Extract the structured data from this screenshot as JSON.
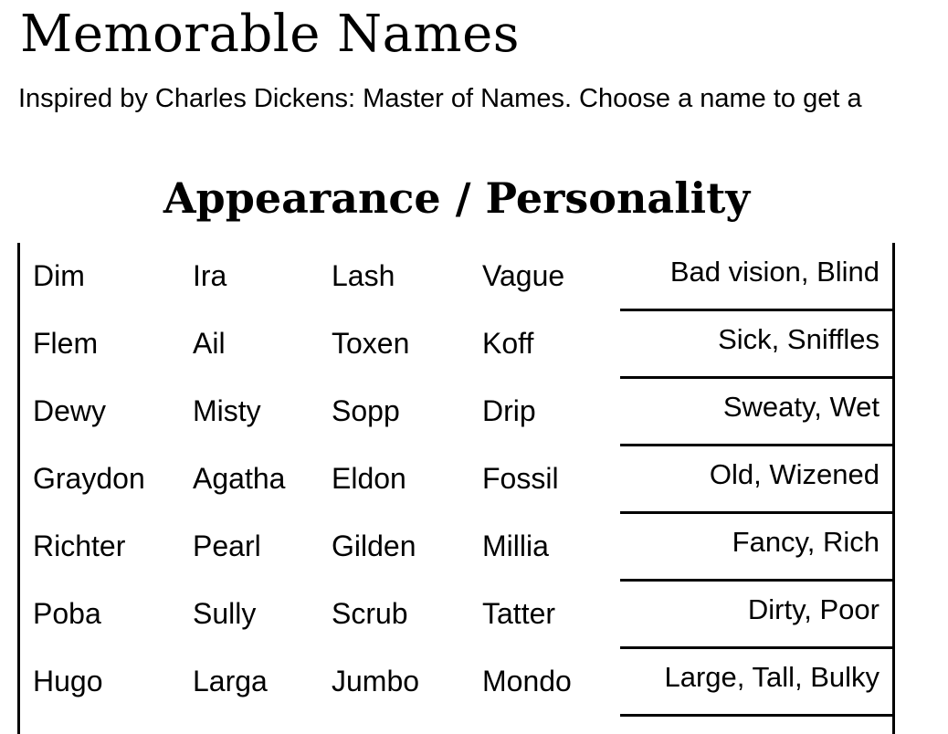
{
  "page": {
    "title": "Memorable Names",
    "subtitle": "Inspired by Charles Dickens: Master of Names. Choose a name to get a"
  },
  "section": {
    "heading": "Appearance / Personality",
    "rows": [
      {
        "names": [
          "Dim",
          "Ira",
          "Lash",
          "Vague"
        ],
        "trait": "Bad vision, Blind"
      },
      {
        "names": [
          "Flem",
          "Ail",
          "Toxen",
          "Koff"
        ],
        "trait": "Sick, Sniffles"
      },
      {
        "names": [
          "Dewy",
          "Misty",
          "Sopp",
          "Drip"
        ],
        "trait": "Sweaty, Wet"
      },
      {
        "names": [
          "Graydon",
          "Agatha",
          "Eldon",
          "Fossil"
        ],
        "trait": "Old, Wizened"
      },
      {
        "names": [
          "Richter",
          "Pearl",
          "Gilden",
          "Millia"
        ],
        "trait": "Fancy, Rich"
      },
      {
        "names": [
          "Poba",
          "Sully",
          "Scrub",
          "Tatter"
        ],
        "trait": "Dirty, Poor"
      },
      {
        "names": [
          "Hugo",
          "Larga",
          "Jumbo",
          "Mondo"
        ],
        "trait": "Large, Tall, Bulky"
      }
    ]
  }
}
